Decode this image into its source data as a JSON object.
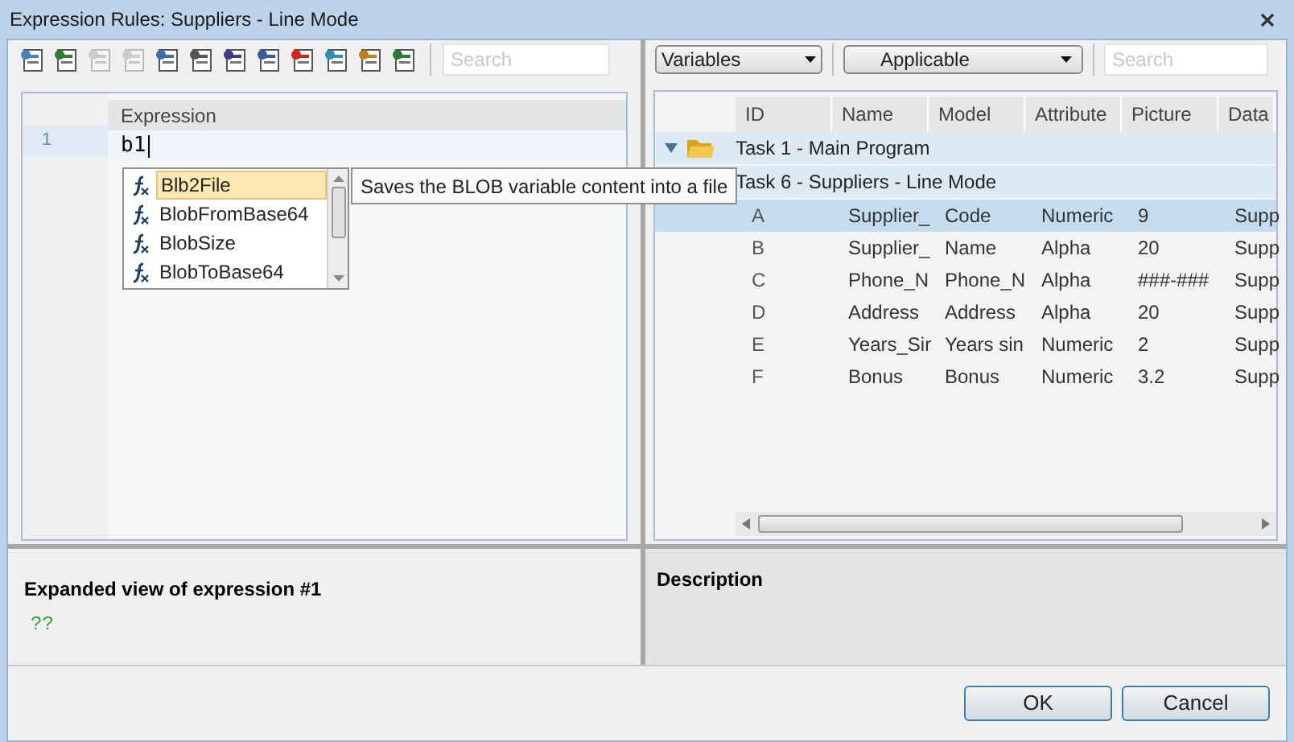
{
  "window": {
    "title": "Expression Rules: Suppliers - Line Mode"
  },
  "toolbar_buttons": [
    {
      "disabled": false
    },
    {
      "disabled": false
    },
    {
      "disabled": true
    },
    {
      "disabled": true
    },
    {
      "disabled": false
    },
    {
      "disabled": false
    },
    {
      "disabled": false
    },
    {
      "disabled": false
    },
    {
      "disabled": false
    },
    {
      "disabled": false
    },
    {
      "disabled": false
    },
    {
      "disabled": false
    }
  ],
  "left_search": {
    "placeholder": "Search"
  },
  "editor": {
    "column": "Expression",
    "lines": [
      {
        "number": "1",
        "text": "b1"
      }
    ]
  },
  "autocomplete": {
    "items": [
      {
        "label": "Blb2File",
        "selected": true
      },
      {
        "label": "BlobFromBase64",
        "selected": false
      },
      {
        "label": "BlobSize",
        "selected": false
      },
      {
        "label": "BlobToBase64",
        "selected": false
      }
    ],
    "tooltip": "Saves the BLOB variable content into a file"
  },
  "filters": {
    "type": "Variables",
    "scope": "Applicable",
    "search_placeholder": "Search"
  },
  "grid": {
    "columns": [
      "ID",
      "Name",
      "Model",
      "Attribute",
      "Picture",
      "Data"
    ],
    "tasks": [
      {
        "label": "Task  1 - Main Program",
        "expanded": true,
        "children": [
          {
            "label": "Task  6 - Suppliers - Line Mode",
            "rows": [
              {
                "cells": [
                  "A",
                  "Supplier_",
                  "Code",
                  "Numeric",
                  "9",
                  "Supp"
                ],
                "selected": true
              },
              {
                "cells": [
                  "B",
                  "Supplier_",
                  "Name",
                  "Alpha",
                  "20",
                  "Supp"
                ],
                "selected": false
              },
              {
                "cells": [
                  "C",
                  "Phone_N",
                  "Phone_N",
                  "Alpha",
                  "###-###",
                  "Supp"
                ],
                "selected": false
              },
              {
                "cells": [
                  "D",
                  "Address",
                  "Address",
                  "Alpha",
                  "20",
                  "Supp"
                ],
                "selected": false
              },
              {
                "cells": [
                  "E",
                  "Years_Sir",
                  "Years sin",
                  "Numeric",
                  "2",
                  "Supp"
                ],
                "selected": false
              },
              {
                "cells": [
                  "F",
                  "Bonus",
                  "Bonus",
                  "Numeric",
                  "3.2",
                  "Supp"
                ],
                "selected": false
              }
            ]
          }
        ]
      }
    ]
  },
  "expanded_view": {
    "title": "Expanded view of expression #1",
    "value": "??"
  },
  "description": {
    "title": "Description"
  },
  "buttons": [
    "OK",
    "Cancel"
  ]
}
